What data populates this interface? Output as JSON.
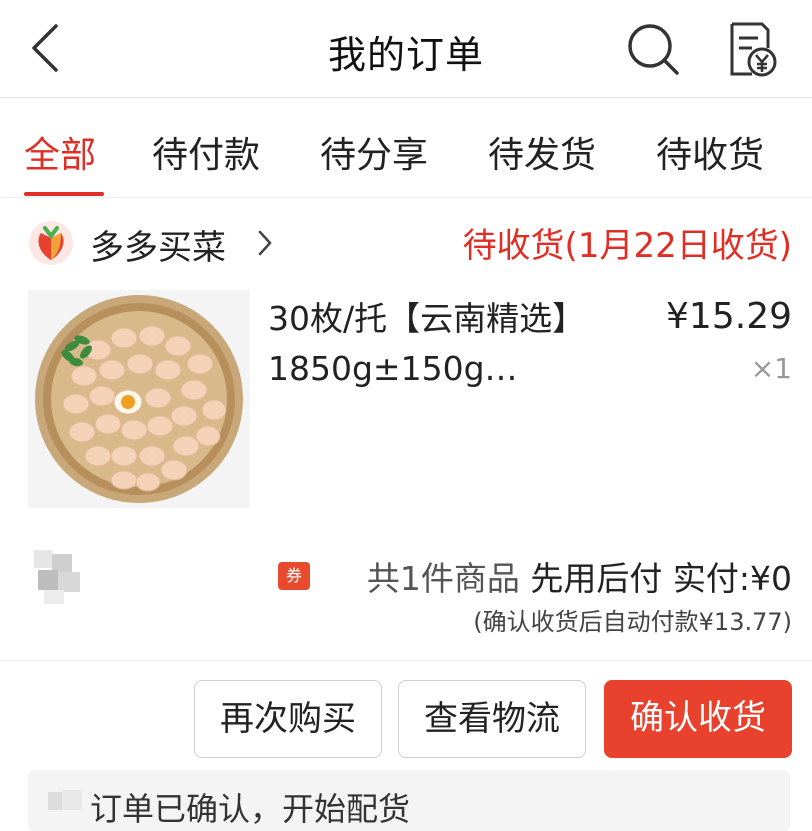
{
  "header": {
    "title": "我的订单",
    "back_icon": "back-arrow-icon",
    "search_icon": "search-icon",
    "bill_icon": "receipt-yen-icon"
  },
  "tabs": [
    {
      "label": "全部",
      "active": true
    },
    {
      "label": "待付款",
      "active": false
    },
    {
      "label": "待分享",
      "active": false
    },
    {
      "label": "待发货",
      "active": false
    },
    {
      "label": "待收货",
      "active": false
    }
  ],
  "order": {
    "shop_name": "多多买菜",
    "status": "待收货(1月22日收货)",
    "product": {
      "title": "30枚/托【云南精选】1850g±150g…",
      "price": "¥15.29",
      "quantity": "×1"
    },
    "summary": {
      "coupon_label": "券",
      "items": "共1件商品",
      "pay_mode": "先用后付",
      "paid_label": "实付:",
      "paid_amount": "¥0",
      "auto_pay_note": "(确认收货后自动付款¥13.77)"
    },
    "actions": {
      "buy_again": "再次购买",
      "view_logistics": "查看物流",
      "confirm_receipt": "确认收货"
    },
    "logistics_status": "订单已确认，开始配货"
  },
  "colors": {
    "accent": "#e02e24",
    "confirm_button": "#e8422f"
  }
}
